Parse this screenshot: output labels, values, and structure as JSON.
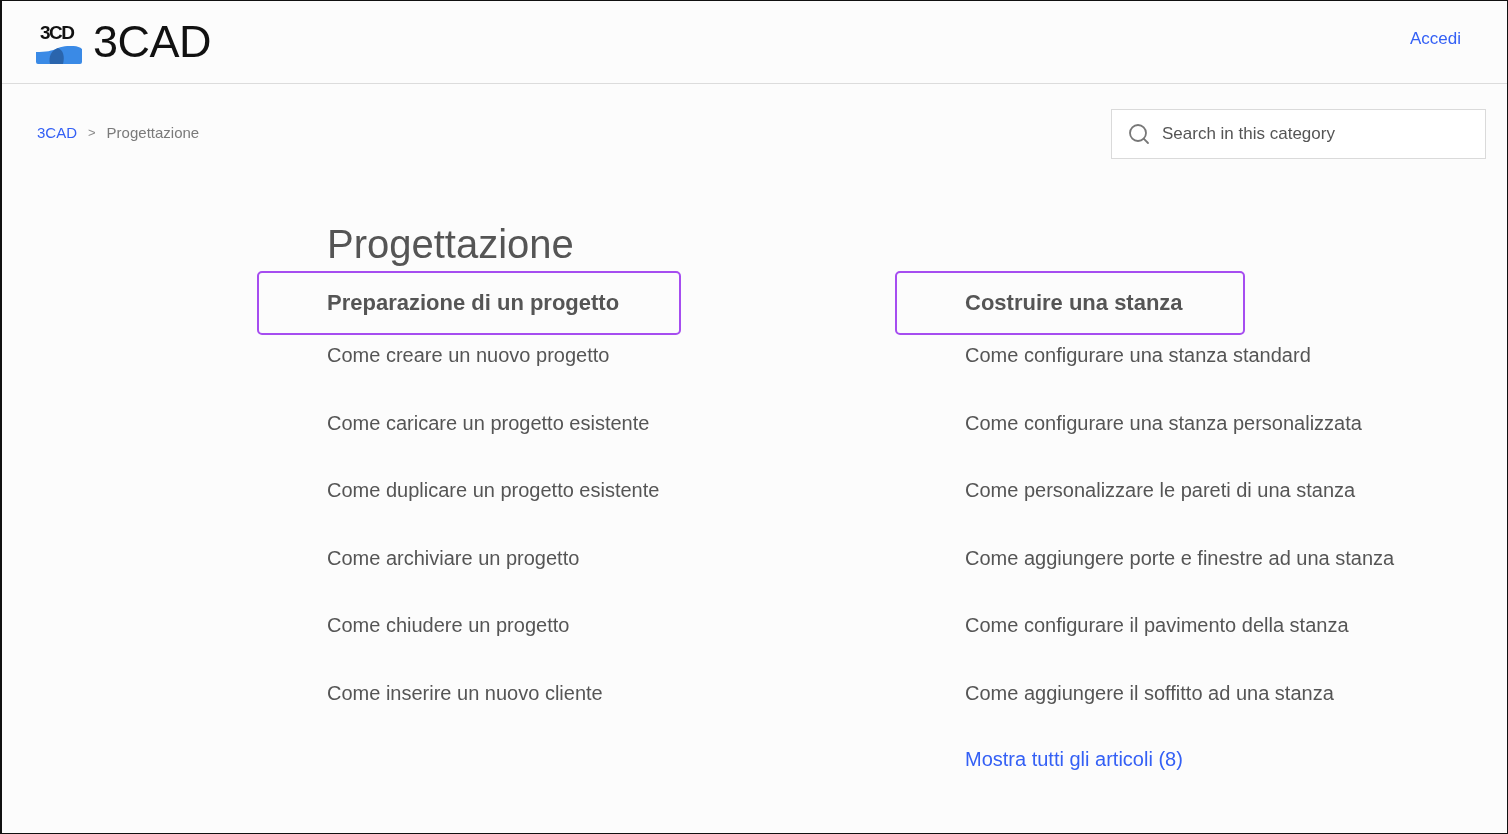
{
  "header": {
    "logo": {
      "mark_text": "3CD",
      "name": "3CAD"
    },
    "sign_in": "Accedi"
  },
  "breadcrumb": {
    "separator": ">",
    "items": [
      {
        "label": "3CAD",
        "current": false
      },
      {
        "label": "Progettazione",
        "current": true
      }
    ]
  },
  "search": {
    "placeholder": "Search in this category"
  },
  "title": "Progettazione",
  "sections": [
    {
      "title": "Preparazione di un progetto",
      "highlighted": true,
      "articles": [
        "Come creare un nuovo progetto",
        "Come caricare un progetto esistente",
        "Come duplicare un progetto esistente",
        "Come archiviare un progetto",
        "Come chiudere un progetto",
        "Come inserire un nuovo cliente"
      ]
    },
    {
      "title": "Costruire una stanza",
      "highlighted": true,
      "articles": [
        "Come configurare una stanza standard",
        "Come configurare una stanza personalizzata",
        "Come personalizzare le pareti di una stanza",
        "Come aggiungere porte e finestre ad una stanza",
        "Come configurare il pavimento della stanza",
        "Come aggiungere il soffitto ad una stanza"
      ],
      "more_link": "Mostra tutti gli articoli (8)"
    }
  ]
}
